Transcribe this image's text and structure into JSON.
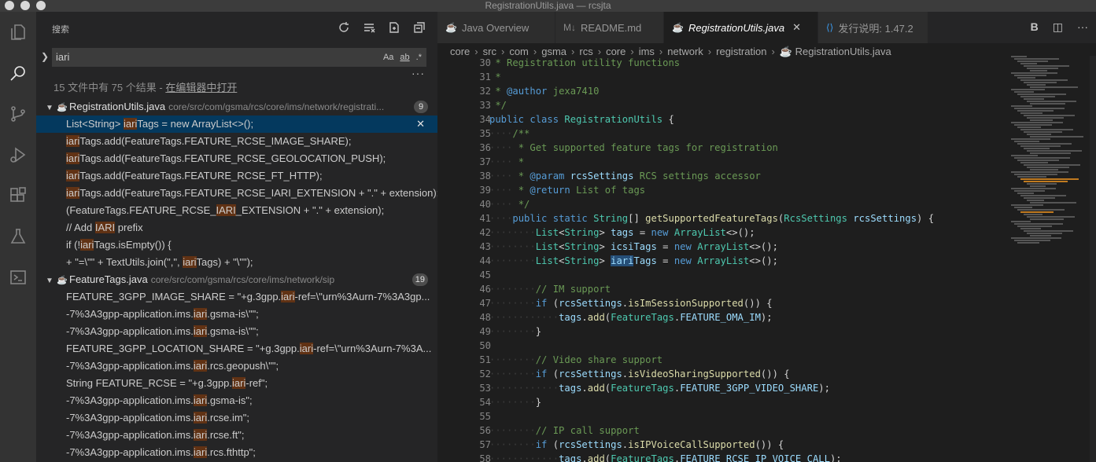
{
  "window": {
    "title": "RegistrationUtils.java — rcsjta"
  },
  "activity_bar": [
    "files-icon",
    "search-icon",
    "source-control-icon",
    "run-debug-icon",
    "extensions-icon",
    "testing-icon",
    "remote-explorer-icon"
  ],
  "sidebar": {
    "title": "搜索",
    "search_value": "iari",
    "option_match_case": "Aa",
    "option_whole_word": "ab",
    "option_regex": ".*",
    "more": "···",
    "summary_prefix": "15 文件中有 75 个结果 - ",
    "summary_link": "在编辑器中打开",
    "files": [
      {
        "name": "RegistrationUtils.java",
        "path": "core/src/com/gsma/rcs/core/ims/network/registrati...",
        "count": "9",
        "matches": [
          {
            "before": "List<String> ",
            "hit": "iari",
            "after": "Tags = new ArrayList<>();",
            "selected": true
          },
          {
            "before": "",
            "hit": "iari",
            "after": "Tags.add(FeatureTags.FEATURE_RCSE_IMAGE_SHARE);"
          },
          {
            "before": "",
            "hit": "iari",
            "after": "Tags.add(FeatureTags.FEATURE_RCSE_GEOLOCATION_PUSH);"
          },
          {
            "before": "",
            "hit": "iari",
            "after": "Tags.add(FeatureTags.FEATURE_RCSE_FT_HTTP);"
          },
          {
            "before": "",
            "hit": "iari",
            "after": "Tags.add(FeatureTags.FEATURE_RCSE_IARI_EXTENSION + \".\" + extension);"
          },
          {
            "before": "(FeatureTags.FEATURE_RCSE_",
            "hit": "IARI",
            "after": "_EXTENSION + \".\" + extension);"
          },
          {
            "before": "// Add ",
            "hit": "IARI",
            "after": " prefix"
          },
          {
            "before": "if (!",
            "hit": "iari",
            "after": "Tags.isEmpty()) {"
          },
          {
            "before": "+ \"=\\\"\" + TextUtils.join(\",\", ",
            "hit": "iari",
            "after": "Tags) + \"\\\"\");"
          }
        ]
      },
      {
        "name": "FeatureTags.java",
        "path": "core/src/com/gsma/rcs/core/ims/network/sip",
        "count": "19",
        "matches": [
          {
            "before": "FEATURE_3GPP_IMAGE_SHARE = \"+g.3gpp.",
            "hit": "iari",
            "after": "-ref=\\\"urn%3Aurn-7%3A3gp..."
          },
          {
            "before": "-7%3A3gpp-application.ims.",
            "hit": "iari",
            "after": ".gsma-is\\\"\";"
          },
          {
            "before": "-7%3A3gpp-application.ims.",
            "hit": "iari",
            "after": ".gsma-is\\\"\";"
          },
          {
            "before": "FEATURE_3GPP_LOCATION_SHARE = \"+g.3gpp.",
            "hit": "iari",
            "after": "-ref=\\\"urn%3Aurn-7%3A..."
          },
          {
            "before": "-7%3A3gpp-application.ims.",
            "hit": "iari",
            "after": ".rcs.geopush\\\"\";"
          },
          {
            "before": "String FEATURE_RCSE = \"+g.3gpp.",
            "hit": "iari",
            "after": "-ref\";"
          },
          {
            "before": "-7%3A3gpp-application.ims.",
            "hit": "iari",
            "after": ".gsma-is\";"
          },
          {
            "before": "-7%3A3gpp-application.ims.",
            "hit": "iari",
            "after": ".rcse.im\";"
          },
          {
            "before": "-7%3A3gpp-application.ims.",
            "hit": "iari",
            "after": ".rcse.ft\";"
          },
          {
            "before": "-7%3A3gpp-application.ims.",
            "hit": "iari",
            "after": ".rcs.fthttp\";"
          }
        ]
      }
    ]
  },
  "editor": {
    "tabs": [
      {
        "label": "Java Overview",
        "icon": "java-icon",
        "active": false
      },
      {
        "label": "README.md",
        "icon": "markdown-icon",
        "active": false
      },
      {
        "label": "RegistrationUtils.java",
        "icon": "java-icon",
        "active": true,
        "close": "✕"
      },
      {
        "label": "发行说明: 1.47.2",
        "icon": "vscode-icon",
        "active": false
      }
    ],
    "breadcrumb": [
      "core",
      "src",
      "com",
      "gsma",
      "rcs",
      "core",
      "ims",
      "network",
      "registration",
      "RegistrationUtils.java"
    ],
    "lines": [
      {
        "n": "30",
        "html": "<span class='cm'> * Registration utility functions</span>"
      },
      {
        "n": "31",
        "html": "<span class='cm'> *</span>"
      },
      {
        "n": "32",
        "html": "<span class='cm'> * </span><span class='an'>@author</span><span class='cm'> jexa7410</span>"
      },
      {
        "n": "33",
        "html": "<span class='cm'> */</span>"
      },
      {
        "n": "34",
        "html": "<span class='kw'>public</span> <span class='kw'>class</span> <span class='ty'>RegistrationUtils</span> {"
      },
      {
        "n": "35",
        "html": "<span class='dot'>····</span><span class='cm'>/**</span>"
      },
      {
        "n": "36",
        "html": "<span class='dot'>····</span><span class='cm'> * Get supported feature tags for registration</span>"
      },
      {
        "n": "37",
        "html": "<span class='dot'>····</span><span class='cm'> *</span>"
      },
      {
        "n": "38",
        "html": "<span class='dot'>····</span><span class='cm'> * </span><span class='an'>@param</span> <span class='vr'>rcsSettings</span><span class='cm'> RCS settings accessor</span>"
      },
      {
        "n": "39",
        "html": "<span class='dot'>····</span><span class='cm'> * </span><span class='an'>@return</span><span class='cm'> List of tags</span>"
      },
      {
        "n": "40",
        "html": "<span class='dot'>····</span><span class='cm'> */</span>"
      },
      {
        "n": "41",
        "html": "<span class='dot'>····</span><span class='kw'>public</span> <span class='kw'>static</span> <span class='ty'>String</span>[] <span class='fn'>getSupportedFeatureTags</span>(<span class='ty'>RcsSettings</span> <span class='vr'>rcsSettings</span>) {"
      },
      {
        "n": "42",
        "html": "<span class='dot'>········</span><span class='ty'>List</span>&lt;<span class='ty'>String</span>&gt; <span class='vr'>tags</span> = <span class='kw'>new</span> <span class='ty'>ArrayList</span>&lt;&gt;();"
      },
      {
        "n": "43",
        "html": "<span class='dot'>········</span><span class='ty'>List</span>&lt;<span class='ty'>String</span>&gt; <span class='vr'>icsiTags</span> = <span class='kw'>new</span> <span class='ty'>ArrayList</span>&lt;&gt;();"
      },
      {
        "n": "44",
        "html": "<span class='dot'>········</span><span class='ty'>List</span>&lt;<span class='ty'>String</span>&gt; <span class='vr'><span class='selw'>iari</span>Tags</span> = <span class='kw'>new</span> <span class='ty'>ArrayList</span>&lt;&gt;();"
      },
      {
        "n": "45",
        "html": ""
      },
      {
        "n": "46",
        "html": "<span class='dot'>········</span><span class='cm'>// IM support</span>"
      },
      {
        "n": "47",
        "html": "<span class='dot'>········</span><span class='kw'>if</span> (<span class='vr'>rcsSettings</span>.<span class='fn'>isImSessionSupported</span>()) {"
      },
      {
        "n": "48",
        "html": "<span class='dot'>············</span><span class='vr'>tags</span>.<span class='fn'>add</span>(<span class='ty'>FeatureTags</span>.<span class='vr'>FEATURE_OMA_IM</span>);"
      },
      {
        "n": "49",
        "html": "<span class='dot'>········</span>}"
      },
      {
        "n": "50",
        "html": ""
      },
      {
        "n": "51",
        "html": "<span class='dot'>········</span><span class='cm'>// Video share support</span>"
      },
      {
        "n": "52",
        "html": "<span class='dot'>········</span><span class='kw'>if</span> (<span class='vr'>rcsSettings</span>.<span class='fn'>isVideoSharingSupported</span>()) {"
      },
      {
        "n": "53",
        "html": "<span class='dot'>············</span><span class='vr'>tags</span>.<span class='fn'>add</span>(<span class='ty'>FeatureTags</span>.<span class='vr'>FEATURE_3GPP_VIDEO_SHARE</span>);"
      },
      {
        "n": "54",
        "html": "<span class='dot'>········</span>}"
      },
      {
        "n": "55",
        "html": ""
      },
      {
        "n": "56",
        "html": "<span class='dot'>········</span><span class='cm'>// IP call support</span>"
      },
      {
        "n": "57",
        "html": "<span class='dot'>········</span><span class='kw'>if</span> (<span class='vr'>rcsSettings</span>.<span class='fn'>isIPVoiceCallSupported</span>()) {"
      },
      {
        "n": "58",
        "html": "<span class='dot'>············</span><span class='vr'>tags</span>.<span class='fn'>add</span>(<span class='ty'>FeatureTags</span>.<span class='vr'>FEATURE_RCSE_IP_VOICE_CALL</span>);"
      }
    ]
  },
  "colors": {
    "accent": "#007acc",
    "selection": "#04395e",
    "match_highlight": "#613214"
  }
}
